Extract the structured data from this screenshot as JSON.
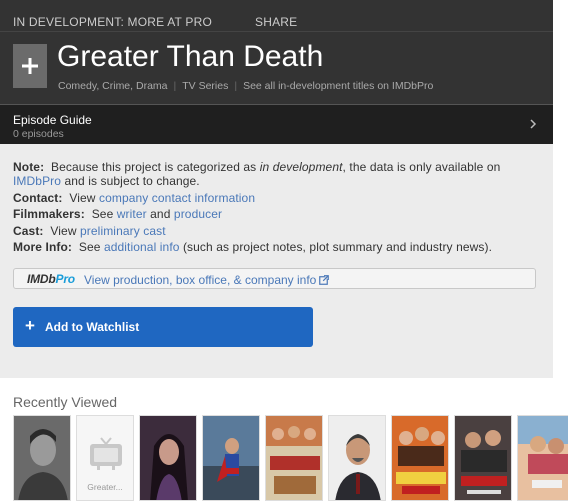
{
  "topbar": {
    "dev_link": "IN DEVELOPMENT: MORE AT PRO",
    "share_link": "SHARE"
  },
  "title": {
    "name": "Greater Than Death",
    "genres": "Comedy, Crime, Drama",
    "type": "TV Series",
    "pro_link": "See all in-development titles on IMDbPro"
  },
  "episode_guide": {
    "label": "Episode Guide",
    "count": "0 episodes"
  },
  "info": {
    "note_label": "Note:",
    "note_a": "Because this project is categorized as ",
    "note_em": "in development",
    "note_b": ", the data is only available on",
    "note_link": "IMDbPro",
    "note_c": " and is subject to change.",
    "contact_label": "Contact:",
    "contact_pre": "View ",
    "contact_link": "company contact information",
    "filmmakers_label": "Filmmakers:",
    "filmmakers_pre": "See ",
    "filmmakers_link1": "writer",
    "filmmakers_mid": " and ",
    "filmmakers_link2": "producer",
    "cast_label": "Cast:",
    "cast_pre": "View ",
    "cast_link": "preliminary cast",
    "more_label": "More Info:",
    "more_pre": "See ",
    "more_link": "additional info",
    "more_post": " (such as project notes, plot summary and industry news)."
  },
  "pro_bar": {
    "logo_a": "IMDb",
    "logo_b": "Pro",
    "link": "View production, box office, & company info"
  },
  "watchlist": {
    "plus": "+",
    "label": "Add to Watchlist"
  },
  "recently_viewed": {
    "title": "Recently Viewed",
    "placeholder_caption": "Greater...",
    "thumb_colors": [
      "#5a5a5a",
      "#f2f2f2",
      "#4a3a48",
      "#3a4a60",
      "#b8553a",
      "#e8e8e8",
      "#c45a2a",
      "#b8562e",
      "#2e3440",
      "#d8a07a"
    ]
  },
  "colors": {
    "header_bg": "#333333",
    "episode_bg": "#1f1f1f",
    "info_bg": "#ececec",
    "link": "#4a78b8",
    "button": "#1f67c1"
  }
}
